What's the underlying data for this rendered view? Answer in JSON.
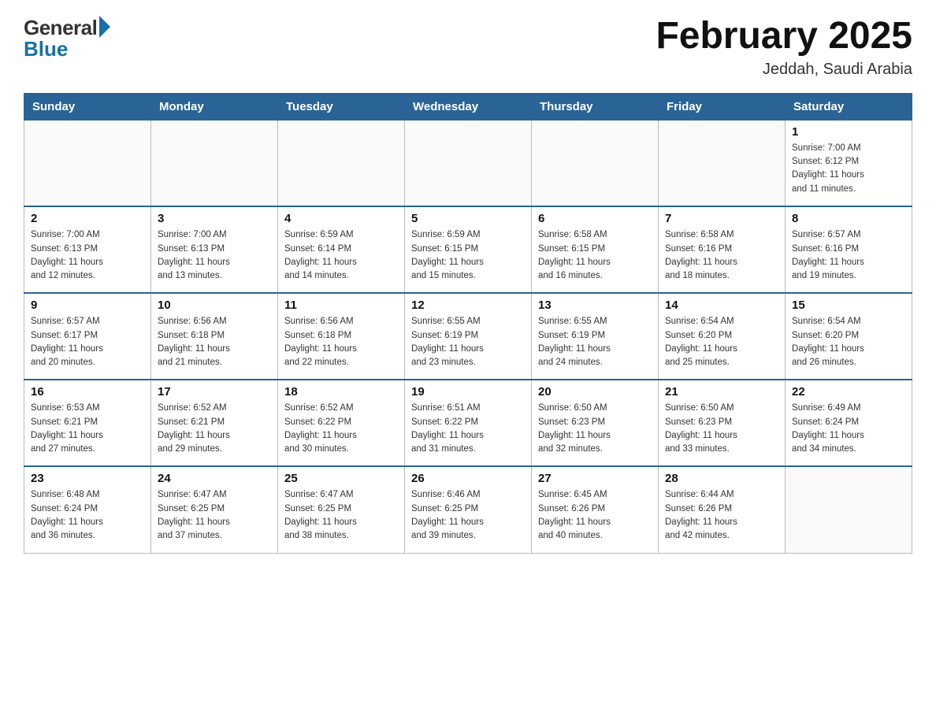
{
  "header": {
    "logo_general": "General",
    "logo_blue": "Blue",
    "month_title": "February 2025",
    "location": "Jeddah, Saudi Arabia"
  },
  "days_of_week": [
    "Sunday",
    "Monday",
    "Tuesday",
    "Wednesday",
    "Thursday",
    "Friday",
    "Saturday"
  ],
  "weeks": [
    [
      {
        "day": "",
        "info": ""
      },
      {
        "day": "",
        "info": ""
      },
      {
        "day": "",
        "info": ""
      },
      {
        "day": "",
        "info": ""
      },
      {
        "day": "",
        "info": ""
      },
      {
        "day": "",
        "info": ""
      },
      {
        "day": "1",
        "info": "Sunrise: 7:00 AM\nSunset: 6:12 PM\nDaylight: 11 hours\nand 11 minutes."
      }
    ],
    [
      {
        "day": "2",
        "info": "Sunrise: 7:00 AM\nSunset: 6:13 PM\nDaylight: 11 hours\nand 12 minutes."
      },
      {
        "day": "3",
        "info": "Sunrise: 7:00 AM\nSunset: 6:13 PM\nDaylight: 11 hours\nand 13 minutes."
      },
      {
        "day": "4",
        "info": "Sunrise: 6:59 AM\nSunset: 6:14 PM\nDaylight: 11 hours\nand 14 minutes."
      },
      {
        "day": "5",
        "info": "Sunrise: 6:59 AM\nSunset: 6:15 PM\nDaylight: 11 hours\nand 15 minutes."
      },
      {
        "day": "6",
        "info": "Sunrise: 6:58 AM\nSunset: 6:15 PM\nDaylight: 11 hours\nand 16 minutes."
      },
      {
        "day": "7",
        "info": "Sunrise: 6:58 AM\nSunset: 6:16 PM\nDaylight: 11 hours\nand 18 minutes."
      },
      {
        "day": "8",
        "info": "Sunrise: 6:57 AM\nSunset: 6:16 PM\nDaylight: 11 hours\nand 19 minutes."
      }
    ],
    [
      {
        "day": "9",
        "info": "Sunrise: 6:57 AM\nSunset: 6:17 PM\nDaylight: 11 hours\nand 20 minutes."
      },
      {
        "day": "10",
        "info": "Sunrise: 6:56 AM\nSunset: 6:18 PM\nDaylight: 11 hours\nand 21 minutes."
      },
      {
        "day": "11",
        "info": "Sunrise: 6:56 AM\nSunset: 6:18 PM\nDaylight: 11 hours\nand 22 minutes."
      },
      {
        "day": "12",
        "info": "Sunrise: 6:55 AM\nSunset: 6:19 PM\nDaylight: 11 hours\nand 23 minutes."
      },
      {
        "day": "13",
        "info": "Sunrise: 6:55 AM\nSunset: 6:19 PM\nDaylight: 11 hours\nand 24 minutes."
      },
      {
        "day": "14",
        "info": "Sunrise: 6:54 AM\nSunset: 6:20 PM\nDaylight: 11 hours\nand 25 minutes."
      },
      {
        "day": "15",
        "info": "Sunrise: 6:54 AM\nSunset: 6:20 PM\nDaylight: 11 hours\nand 26 minutes."
      }
    ],
    [
      {
        "day": "16",
        "info": "Sunrise: 6:53 AM\nSunset: 6:21 PM\nDaylight: 11 hours\nand 27 minutes."
      },
      {
        "day": "17",
        "info": "Sunrise: 6:52 AM\nSunset: 6:21 PM\nDaylight: 11 hours\nand 29 minutes."
      },
      {
        "day": "18",
        "info": "Sunrise: 6:52 AM\nSunset: 6:22 PM\nDaylight: 11 hours\nand 30 minutes."
      },
      {
        "day": "19",
        "info": "Sunrise: 6:51 AM\nSunset: 6:22 PM\nDaylight: 11 hours\nand 31 minutes."
      },
      {
        "day": "20",
        "info": "Sunrise: 6:50 AM\nSunset: 6:23 PM\nDaylight: 11 hours\nand 32 minutes."
      },
      {
        "day": "21",
        "info": "Sunrise: 6:50 AM\nSunset: 6:23 PM\nDaylight: 11 hours\nand 33 minutes."
      },
      {
        "day": "22",
        "info": "Sunrise: 6:49 AM\nSunset: 6:24 PM\nDaylight: 11 hours\nand 34 minutes."
      }
    ],
    [
      {
        "day": "23",
        "info": "Sunrise: 6:48 AM\nSunset: 6:24 PM\nDaylight: 11 hours\nand 36 minutes."
      },
      {
        "day": "24",
        "info": "Sunrise: 6:47 AM\nSunset: 6:25 PM\nDaylight: 11 hours\nand 37 minutes."
      },
      {
        "day": "25",
        "info": "Sunrise: 6:47 AM\nSunset: 6:25 PM\nDaylight: 11 hours\nand 38 minutes."
      },
      {
        "day": "26",
        "info": "Sunrise: 6:46 AM\nSunset: 6:25 PM\nDaylight: 11 hours\nand 39 minutes."
      },
      {
        "day": "27",
        "info": "Sunrise: 6:45 AM\nSunset: 6:26 PM\nDaylight: 11 hours\nand 40 minutes."
      },
      {
        "day": "28",
        "info": "Sunrise: 6:44 AM\nSunset: 6:26 PM\nDaylight: 11 hours\nand 42 minutes."
      },
      {
        "day": "",
        "info": ""
      }
    ]
  ]
}
